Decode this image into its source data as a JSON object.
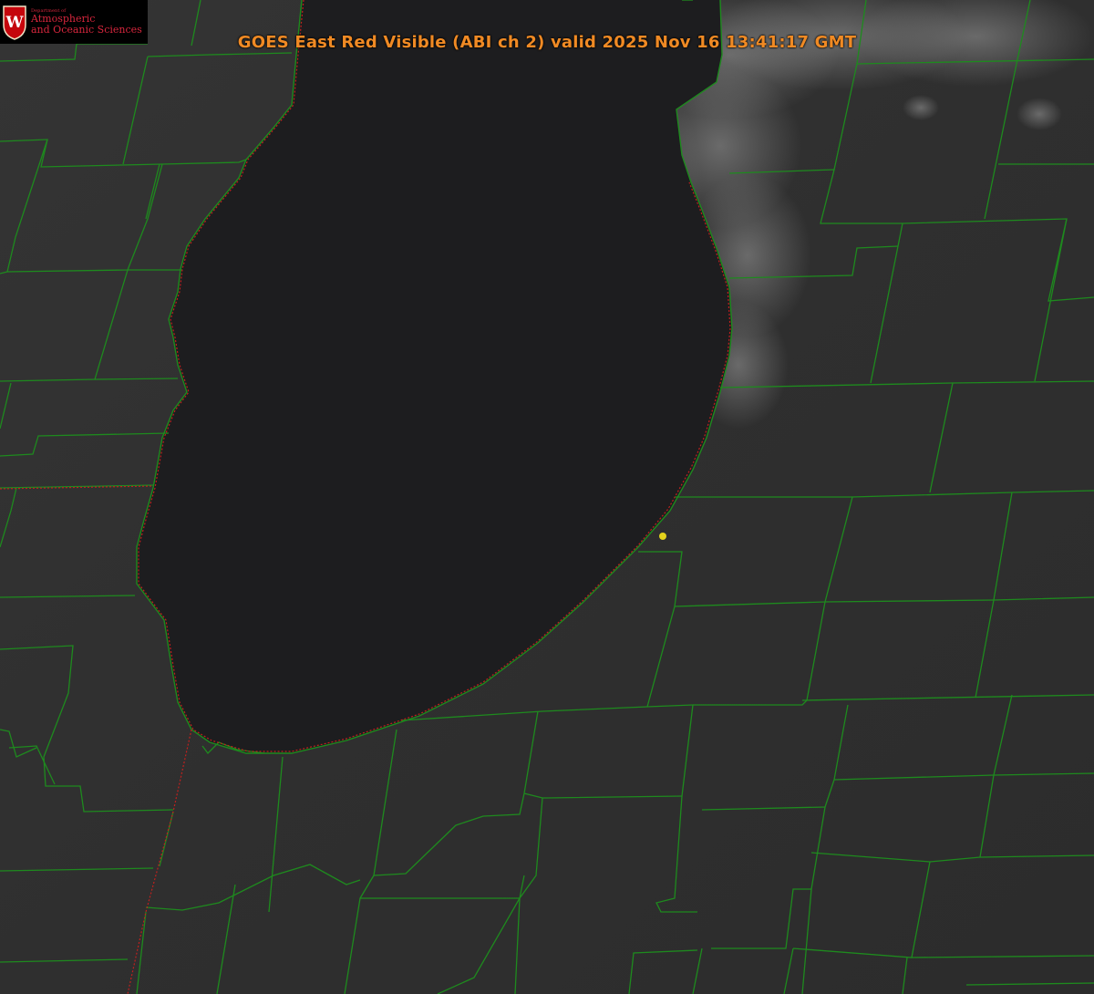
{
  "header": {
    "title": "GOES East Red Visible (ABI ch 2) valid 2025 Nov 16 13:41:17 GMT"
  },
  "logo": {
    "small_text": "Department of",
    "line1": "Atmospheric",
    "line2": "and Oceanic Sciences",
    "crest_letter": "W"
  },
  "map": {
    "product": "GOES East Red Visible (ABI ch 2)",
    "lake_feature": "Lake Michigan (southern basin)",
    "colors": {
      "background": "#303030",
      "lake": "#1d1d1f",
      "county_lines": "#1e8a1e",
      "state_lines": "#c0201e",
      "marker": "#e4d21c",
      "title": "#f08a24",
      "logo_text": "#d7263d"
    },
    "icons": [
      "uw-crest-icon",
      "station-marker-icon"
    ]
  }
}
